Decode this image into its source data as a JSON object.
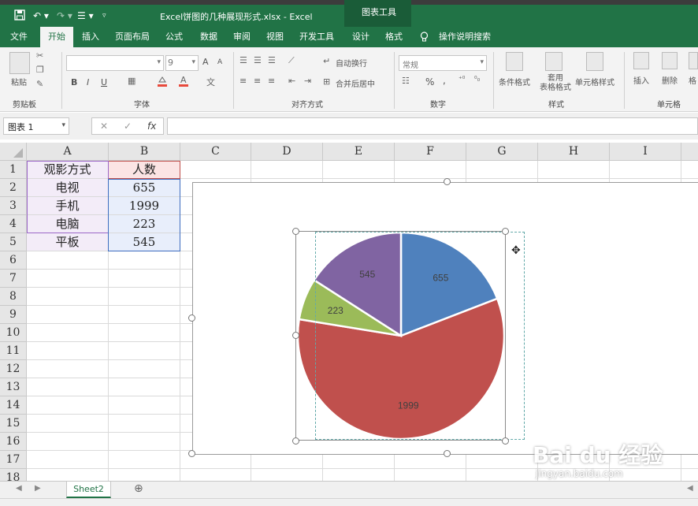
{
  "titlebar": {
    "doc_title": "Excel饼图的几种展现形式.xlsx  -  Excel",
    "context_group": "图表工具",
    "qa_save_icon": "save-icon",
    "qa_undo_icon": "undo-icon",
    "qa_redo_icon": "redo-icon"
  },
  "tabs": [
    "文件",
    "开始",
    "插入",
    "页面布局",
    "公式",
    "数据",
    "审阅",
    "视图",
    "开发工具",
    "设计",
    "格式"
  ],
  "tell_me": "操作说明搜索",
  "ribbon": {
    "clipboard": {
      "label": "剪贴板",
      "paste": "粘贴"
    },
    "font": {
      "label": "字体",
      "size": "9",
      "bold": "B",
      "italic": "I",
      "underline": "U",
      "grow": "A",
      "shrink": "A"
    },
    "alignment": {
      "label": "对齐方式",
      "wrap": "自动换行",
      "merge": "合并后居中"
    },
    "number": {
      "label": "数字",
      "format": "常规",
      "percent": "%",
      "comma": ","
    },
    "styles": {
      "label": "样式",
      "conditional": "条件格式",
      "table": "套用\n表格格式",
      "cell_styles": "单元格样式"
    },
    "cells": {
      "label": "单元格",
      "insert": "插入",
      "delete": "删除",
      "format": "格"
    }
  },
  "formula_bar": {
    "name_box": "图表 1",
    "cancel": "✕",
    "confirm": "✓",
    "fx": "fx",
    "value": ""
  },
  "columns": [
    "A",
    "B",
    "C",
    "D",
    "E",
    "F",
    "G",
    "H",
    "I"
  ],
  "rows": [
    "1",
    "2",
    "3",
    "4",
    "5",
    "6",
    "7",
    "8",
    "9",
    "10",
    "11",
    "12",
    "13",
    "14",
    "15",
    "16",
    "17",
    "18"
  ],
  "table": {
    "header": [
      "观影方式",
      "人数"
    ],
    "rows": [
      [
        "电视",
        "655"
      ],
      [
        "手机",
        "1999"
      ],
      [
        "电脑",
        "223"
      ],
      [
        "平板",
        "545"
      ]
    ]
  },
  "chart_data": {
    "type": "pie",
    "categories": [
      "电视",
      "手机",
      "电脑",
      "平板"
    ],
    "values": [
      655,
      1999,
      223,
      545
    ],
    "colors": [
      "#4f81bd",
      "#c0504d",
      "#9bbb59",
      "#8064a2"
    ],
    "data_labels": [
      "655",
      "1999",
      "223",
      "545"
    ]
  },
  "sheets": [
    "Sheet2"
  ],
  "add_sheet": "⊕",
  "watermark": {
    "logo": "Bai du 经验",
    "url": "jingyan.baidu.com"
  }
}
